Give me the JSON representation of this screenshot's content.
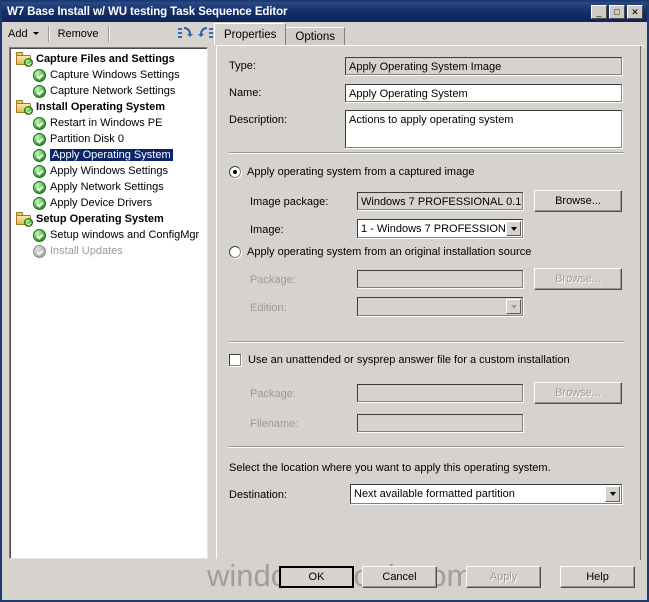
{
  "window": {
    "title": "W7 Base Install w/ WU testing Task Sequence Editor",
    "minimize_label": "_",
    "maximize_label": "□",
    "close_label": "✕"
  },
  "toolbar": {
    "add_label": "Add",
    "remove_label": "Remove",
    "undo_icon": "undo-icon",
    "redo_icon": "redo-icon"
  },
  "tabs": [
    {
      "label": "Properties",
      "selected": true
    },
    {
      "label": "Options",
      "selected": false
    }
  ],
  "tree": {
    "items": [
      {
        "label": "Capture Files and Settings",
        "type": "group",
        "icon": "folder-icon",
        "selected": false,
        "disabled": false
      },
      {
        "label": "Capture Windows Settings",
        "type": "child",
        "icon": "green-check-icon",
        "selected": false,
        "disabled": false
      },
      {
        "label": "Capture Network Settings",
        "type": "child",
        "icon": "green-check-icon",
        "selected": false,
        "disabled": false
      },
      {
        "label": "Install Operating System",
        "type": "group",
        "icon": "folder-icon",
        "selected": false,
        "disabled": false
      },
      {
        "label": "Restart in Windows PE",
        "type": "child",
        "icon": "green-check-icon",
        "selected": false,
        "disabled": false
      },
      {
        "label": "Partition Disk 0",
        "type": "child",
        "icon": "green-check-icon",
        "selected": false,
        "disabled": false
      },
      {
        "label": "Apply Operating System",
        "type": "child",
        "icon": "green-check-icon",
        "selected": true,
        "disabled": false
      },
      {
        "label": "Apply Windows Settings",
        "type": "child",
        "icon": "green-check-icon",
        "selected": false,
        "disabled": false
      },
      {
        "label": "Apply Network Settings",
        "type": "child",
        "icon": "green-check-icon",
        "selected": false,
        "disabled": false
      },
      {
        "label": "Apply Device Drivers",
        "type": "child",
        "icon": "green-check-icon",
        "selected": false,
        "disabled": false
      },
      {
        "label": "Setup Operating System",
        "type": "group",
        "icon": "folder-icon",
        "selected": false,
        "disabled": false
      },
      {
        "label": "Setup windows and ConfigMgr",
        "type": "child",
        "icon": "green-check-icon",
        "selected": false,
        "disabled": false
      },
      {
        "label": "Install Updates",
        "type": "child",
        "icon": "green-check-icon",
        "selected": false,
        "disabled": true
      }
    ]
  },
  "properties": {
    "type_label": "Type:",
    "type_value": "Apply Operating System Image",
    "name_label": "Name:",
    "name_value": "Apply Operating System",
    "description_label": "Description:",
    "description_value": "Actions to apply operating system",
    "captured_radio_label": "Apply operating system from a captured image",
    "image_package_label": "Image package:",
    "image_package_value": "Windows 7 PROFESSIONAL 0.1",
    "image_package_browse": "Browse...",
    "image_label": "Image:",
    "image_value": "1 - Windows 7 PROFESSION",
    "original_radio_label": "Apply operating system from an original installation source",
    "package_label": "Package:",
    "package_value": "",
    "package_browse": "Browse...",
    "edition_label": "Edition:",
    "edition_value": "",
    "unattended_checkbox_label": "Use an unattended or sysprep answer file for a custom installation",
    "unattend_package_label": "Package:",
    "unattend_package_value": "",
    "unattend_package_browse": "Browse...",
    "filename_label": "Filename:",
    "filename_value": "",
    "destination_hint": "Select the location where you want to apply this operating system.",
    "destination_label": "Destination:",
    "destination_value": "Next available formatted partition"
  },
  "footer": {
    "ok_label": "OK",
    "cancel_label": "Cancel",
    "apply_label": "Apply",
    "help_label": "Help",
    "watermark": "windows-noob.com"
  },
  "colors": {
    "titlebar": "#14306b",
    "dialog_bg": "#d6d3ce",
    "selection": "#0a246a",
    "field_bg": "#ffffff"
  }
}
